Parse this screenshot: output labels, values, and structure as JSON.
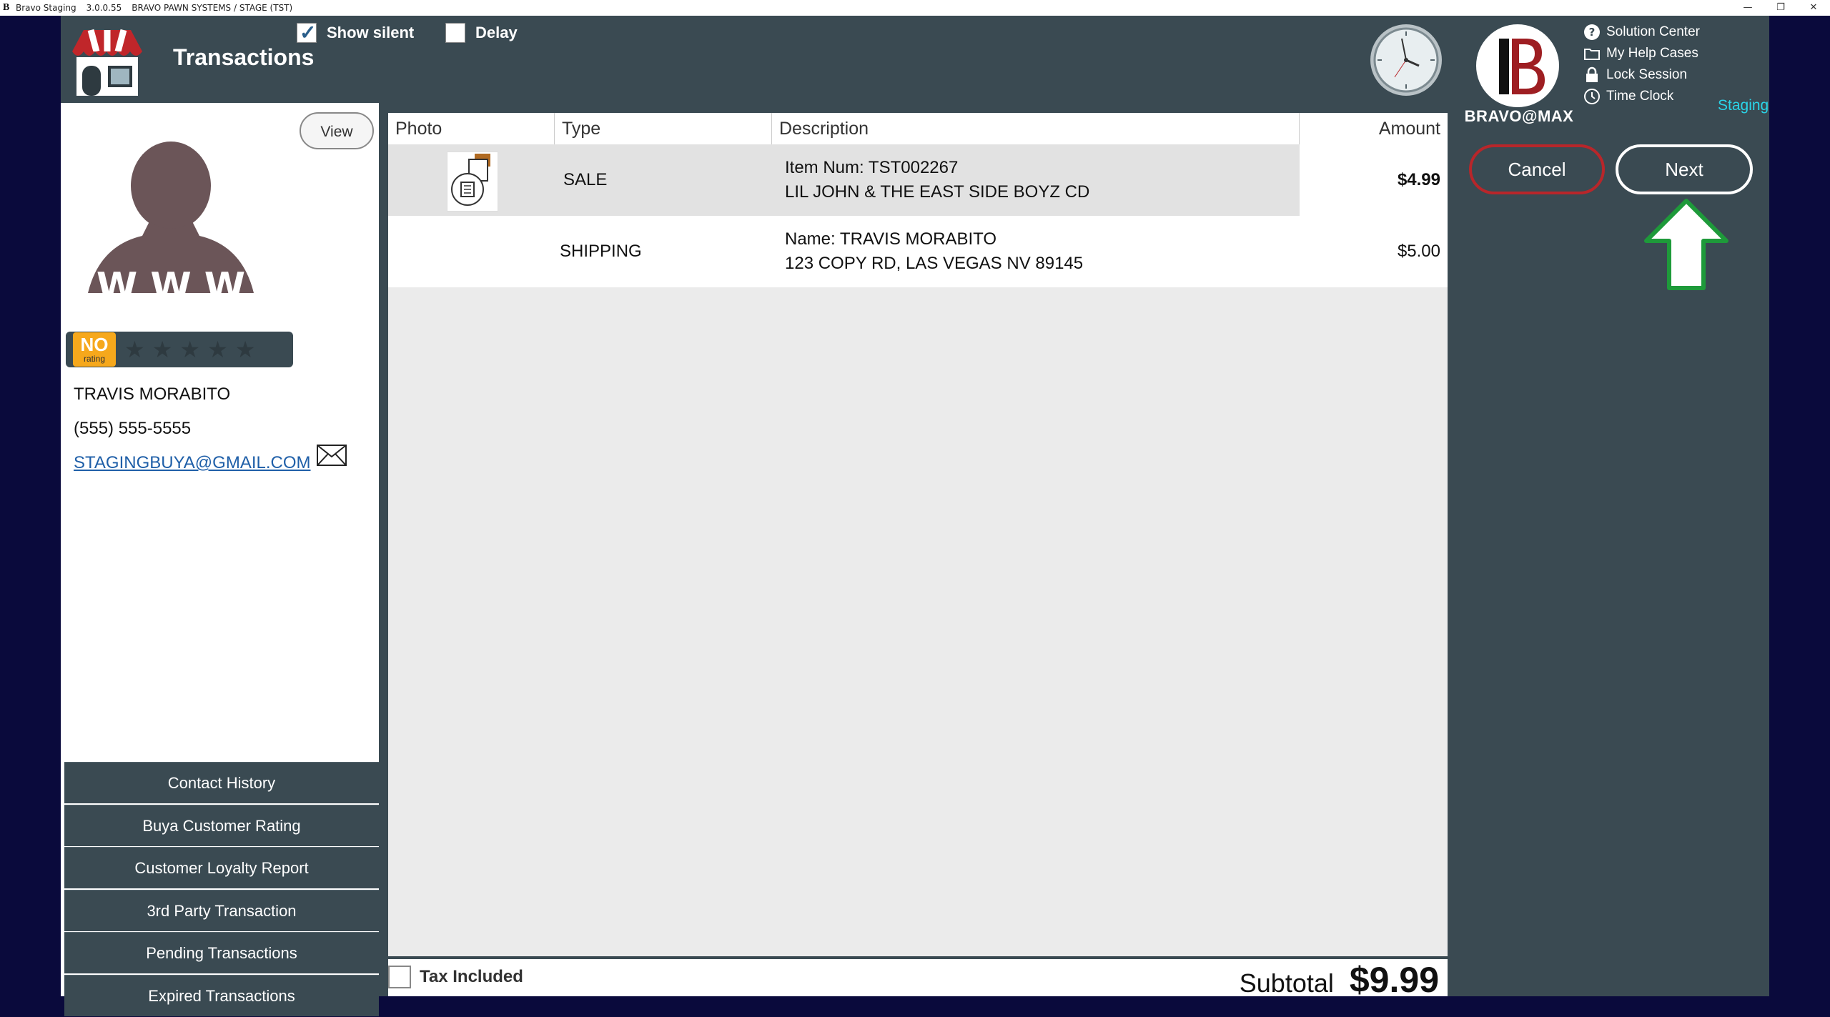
{
  "window": {
    "app_name": "Bravo Staging",
    "version": "3.0.0.55",
    "company": "BRAVO PAWN SYSTEMS / STAGE (TST)",
    "minimize": "—",
    "restore": "❐",
    "close": "✕"
  },
  "header": {
    "title": "Transactions",
    "show_silent_label": "Show silent",
    "show_silent_checked": true,
    "delay_label": "Delay",
    "delay_checked": false,
    "brand_name": "BRAVO@MAX",
    "environment": "Staging",
    "links": [
      {
        "label": "Solution Center",
        "icon": "help-circle-icon"
      },
      {
        "label": "My Help Cases",
        "icon": "folder-icon"
      },
      {
        "label": "Lock Session",
        "icon": "lock-icon"
      },
      {
        "label": "Time Clock",
        "icon": "clock-icon"
      }
    ]
  },
  "customer": {
    "view_label": "View",
    "rating_no": "NO",
    "rating_sub": "rating",
    "stars": 0,
    "name": "TRAVIS MORABITO",
    "phone": "(555) 555-5555",
    "email": "STAGINGBUYA@GMAIL.COM"
  },
  "side_menu": [
    "Contact History",
    "Buya Customer Rating",
    "Customer Loyalty Report",
    "3rd Party Transaction",
    "Pending Transactions",
    "Expired Transactions"
  ],
  "table": {
    "columns": [
      "Photo",
      "Type",
      "Description",
      "Amount"
    ],
    "rows": [
      {
        "type": "SALE",
        "desc1": "Item Num: TST002267",
        "desc2": "LIL JOHN & THE EAST SIDE BOYZ CD",
        "amount": "$4.99",
        "has_photo": true,
        "selected": true
      },
      {
        "type": "SHIPPING",
        "desc1": "Name: TRAVIS MORABITO",
        "desc2": "123 COPY RD, LAS VEGAS NV 89145",
        "amount": "$5.00",
        "has_photo": false,
        "selected": false
      }
    ]
  },
  "footer": {
    "tax_included_label": "Tax Included",
    "tax_included_checked": false,
    "subtotal_label": "Subtotal",
    "subtotal_value": "$9.99"
  },
  "actions": {
    "cancel_label": "Cancel",
    "next_label": "Next"
  },
  "colors": {
    "panel": "#3a4a52",
    "cancel_border": "#b8262a",
    "rating_badge": "#f6a81c",
    "arrow": "#1e9a3a",
    "staging": "#2ad4e8"
  }
}
